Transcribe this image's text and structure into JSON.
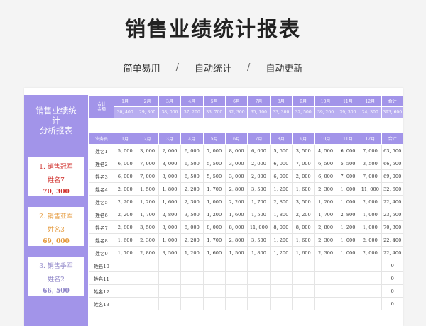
{
  "title": "销售业绩统计报表",
  "subtitle": [
    "简单易用",
    "自动统计",
    "自动更新"
  ],
  "separator": "/",
  "sidebar": {
    "title_lines": [
      "销售业绩统",
      "计",
      "分析报表"
    ],
    "ranks": [
      {
        "label": "1. 销售冠军",
        "name": "姓名7",
        "amount": "70, 300",
        "label_color": "#d0312d",
        "name_color": "#d0312d",
        "amount_color": "#d0312d"
      },
      {
        "label": "2. 销售亚军",
        "name": "姓名3",
        "amount": "69, 000",
        "label_color": "#e59a3c",
        "name_color": "#e59a3c",
        "amount_color": "#e59a3c"
      },
      {
        "label": "3. 销售季军",
        "name": "姓名2",
        "amount": "66, 500",
        "label_color": "#8f86c8",
        "name_color": "#8f86c8",
        "amount_color": "#8f86c8"
      }
    ]
  },
  "totals": {
    "label_lines": [
      "合计",
      "金额"
    ],
    "months": [
      "1月",
      "2月",
      "3月",
      "4月",
      "5月",
      "6月",
      "7月",
      "8月",
      "9月",
      "10月",
      "11月",
      "12月",
      "合计"
    ],
    "values": [
      "30, 400",
      "29, 300",
      "38, 000",
      "37, 200",
      "33, 700",
      "32, 300",
      "35, 100",
      "33, 300",
      "32, 500",
      "39, 200",
      "29, 300",
      "24, 300",
      "393, 600"
    ]
  },
  "table": {
    "headers": [
      "业务员",
      "1月",
      "2月",
      "3月",
      "4月",
      "5月",
      "6月",
      "7月",
      "8月",
      "9月",
      "10月",
      "11月",
      "12月",
      "合计"
    ],
    "rows": [
      [
        "姓名1",
        "5, 000",
        "3, 000",
        "2, 000",
        "6, 000",
        "7, 000",
        "8, 000",
        "6, 000",
        "5, 500",
        "3, 500",
        "4, 500",
        "6, 000",
        "7, 000",
        "63, 500"
      ],
      [
        "姓名2",
        "6, 000",
        "7, 000",
        "8, 000",
        "6, 500",
        "5, 500",
        "3, 000",
        "2, 000",
        "6, 000",
        "7, 000",
        "6, 500",
        "5, 500",
        "3, 500",
        "66, 500"
      ],
      [
        "姓名3",
        "6, 000",
        "7, 000",
        "8, 000",
        "6, 500",
        "5, 500",
        "3, 000",
        "2, 000",
        "6, 000",
        "2, 000",
        "6, 000",
        "7, 000",
        "7, 000",
        "69, 000"
      ],
      [
        "姓名4",
        "2, 000",
        "1, 500",
        "1, 800",
        "2, 200",
        "1, 700",
        "2, 800",
        "3, 500",
        "1, 200",
        "1, 600",
        "2, 300",
        "1, 000",
        "11, 000",
        "32, 600"
      ],
      [
        "姓名5",
        "2, 200",
        "1, 200",
        "1, 600",
        "2, 300",
        "1, 000",
        "2, 200",
        "1, 700",
        "2, 800",
        "3, 500",
        "1, 200",
        "1, 000",
        "2, 000",
        "22, 400"
      ],
      [
        "姓名6",
        "2, 200",
        "1, 700",
        "2, 800",
        "3, 500",
        "1, 200",
        "1, 600",
        "1, 500",
        "1, 800",
        "2, 200",
        "1, 700",
        "2, 800",
        "1, 000",
        "23, 500"
      ],
      [
        "姓名7",
        "2, 800",
        "3, 500",
        "8, 000",
        "8, 000",
        "8, 000",
        "8, 000",
        "11, 000",
        "8, 000",
        "8, 000",
        "2, 800",
        "1, 200",
        "1, 000",
        "70, 300"
      ],
      [
        "姓名8",
        "1, 600",
        "2, 300",
        "1, 000",
        "2, 200",
        "1, 700",
        "2, 800",
        "3, 500",
        "1, 200",
        "1, 600",
        "2, 300",
        "1, 000",
        "2, 000",
        "22, 400"
      ],
      [
        "姓名9",
        "1, 700",
        "2, 800",
        "3, 500",
        "1, 200",
        "1, 600",
        "1, 500",
        "1, 800",
        "1, 200",
        "1, 600",
        "2, 300",
        "1, 000",
        "2, 000",
        "22, 400"
      ],
      [
        "姓名10",
        "",
        "",
        "",
        "",
        "",
        "",
        "",
        "",
        "",
        "",
        "",
        "",
        "0"
      ],
      [
        "姓名11",
        "",
        "",
        "",
        "",
        "",
        "",
        "",
        "",
        "",
        "",
        "",
        "",
        "0"
      ],
      [
        "姓名12",
        "",
        "",
        "",
        "",
        "",
        "",
        "",
        "",
        "",
        "",
        "",
        "",
        "0"
      ],
      [
        "姓名13",
        "",
        "",
        "",
        "",
        "",
        "",
        "",
        "",
        "",
        "",
        "",
        "",
        "0"
      ]
    ]
  }
}
